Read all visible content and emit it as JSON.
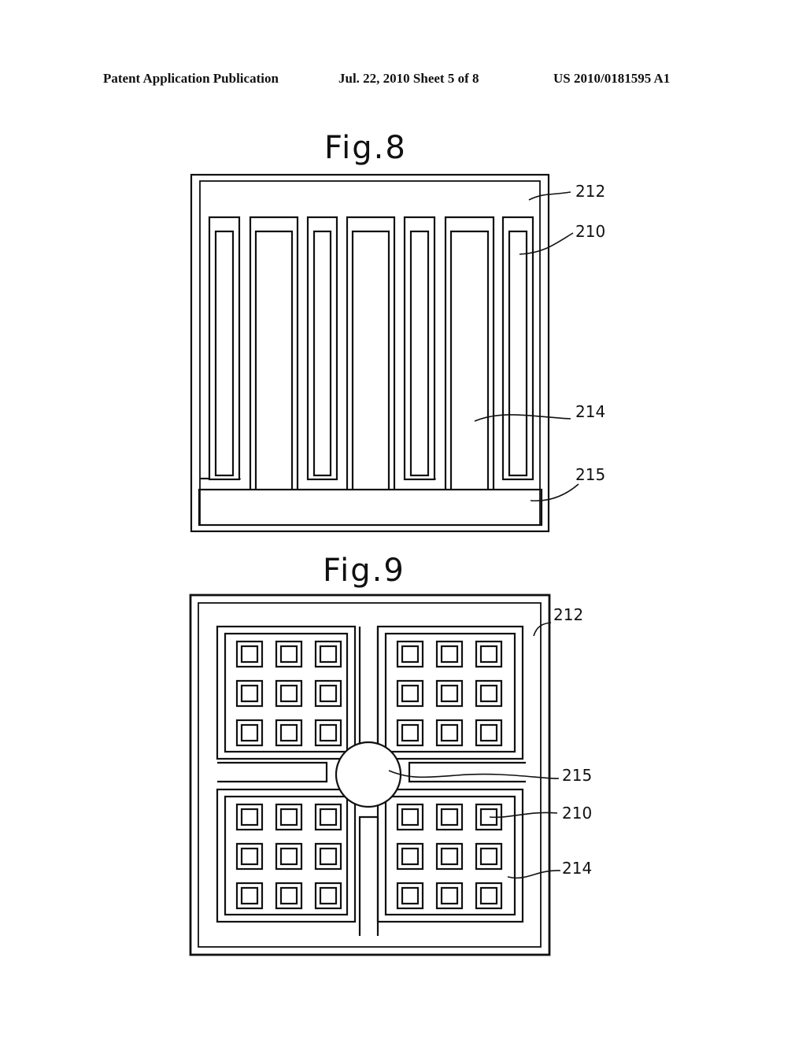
{
  "header": {
    "publication_type": "Patent Application Publication",
    "date_sheet": "Jul. 22, 2010   Sheet 5 of 8",
    "patent_number": "US 2010/0181595 A1"
  },
  "figures": [
    {
      "id": "fig8",
      "title": "Fig.8",
      "description": "Interdigitated comb electrode layout",
      "reference_labels": [
        {
          "id": "212",
          "text": "212"
        },
        {
          "id": "210",
          "text": "210"
        },
        {
          "id": "214",
          "text": "214"
        },
        {
          "id": "215",
          "text": "215"
        }
      ],
      "finger_count": 7
    },
    {
      "id": "fig9",
      "title": "Fig.9",
      "description": "Four-quadrant electrode layout with central circular contact",
      "reference_labels": [
        {
          "id": "212",
          "text": "212"
        },
        {
          "id": "215",
          "text": "215"
        },
        {
          "id": "210",
          "text": "210"
        },
        {
          "id": "214",
          "text": "214"
        }
      ],
      "quadrants": 4,
      "cells_per_quadrant": {
        "rows": 3,
        "cols": 3
      }
    }
  ]
}
